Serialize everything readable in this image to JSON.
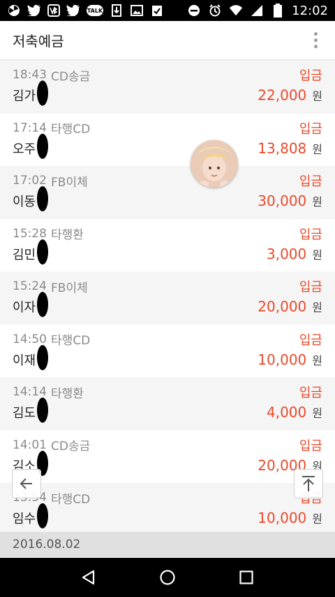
{
  "status_bar": {
    "time": "12:02",
    "talk_label": "TALK",
    "icons": [
      "pinwheel-icon",
      "twitter-icon",
      "vb-icon",
      "twitter-icon",
      "talk-icon",
      "download-icon",
      "image-icon",
      "check-clipboard-icon",
      "dnd-icon",
      "alarm-icon",
      "wifi-icon",
      "signal-icon",
      "battery-icon"
    ]
  },
  "header": {
    "title": "저축예금"
  },
  "transactions": [
    {
      "time": "18:43",
      "type": "CD송금",
      "kind": "입금",
      "name": "김가",
      "amount": "22,000",
      "unit": "원"
    },
    {
      "time": "17:14",
      "type": "타행CD",
      "kind": "입금",
      "name": "오주",
      "amount": "13,808",
      "unit": "원"
    },
    {
      "time": "17:02",
      "type": "FB이체",
      "kind": "입금",
      "name": "이동",
      "amount": "30,000",
      "unit": "원"
    },
    {
      "time": "15:28",
      "type": "타행환",
      "kind": "입금",
      "name": "김민",
      "amount": "3,000",
      "unit": "원"
    },
    {
      "time": "15:24",
      "type": "FB이체",
      "kind": "입금",
      "name": "이자",
      "amount": "20,000",
      "unit": "원"
    },
    {
      "time": "14:50",
      "type": "타행CD",
      "kind": "입금",
      "name": "이재",
      "amount": "10,000",
      "unit": "원"
    },
    {
      "time": "14:14",
      "type": "타행환",
      "kind": "입금",
      "name": "김도",
      "amount": "4,000",
      "unit": "원"
    },
    {
      "time": "14:01",
      "type": "CD송금",
      "kind": "입금",
      "name": "김소",
      "amount": "20,000",
      "unit": "원"
    },
    {
      "time": "13:54",
      "type": "타행CD",
      "kind": "입금",
      "name": "임수",
      "amount": "10,000",
      "unit": "원"
    }
  ],
  "date_separator": "2016.08.02",
  "colors": {
    "accent": "#e8492b",
    "muted": "#8a8a8a",
    "alt_row": "#f5f5f5"
  }
}
